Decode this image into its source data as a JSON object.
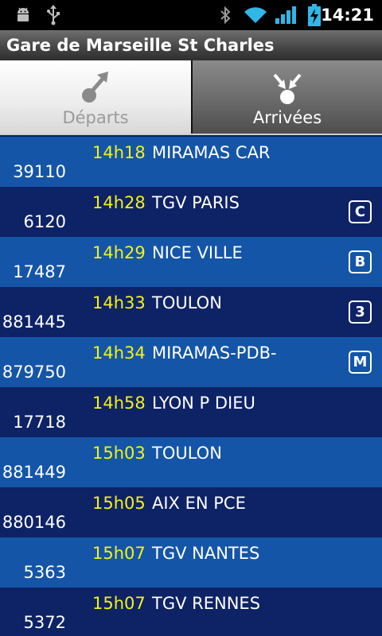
{
  "status_bar": {
    "time": "14:21",
    "icons": [
      "android-debug-icon",
      "usb-icon",
      "bluetooth-icon",
      "wifi-icon",
      "signal-icon",
      "battery-charging-icon"
    ]
  },
  "title": "Gare de Marseille St Charles",
  "tabs": [
    {
      "label": "Départs",
      "icon": "departures-icon",
      "selected": false
    },
    {
      "label": "Arrivées",
      "icon": "arrivals-icon",
      "selected": true
    }
  ],
  "trains": [
    {
      "time": "14h18",
      "destination": "MIRAMAS CAR",
      "number": "39110",
      "platform": ""
    },
    {
      "time": "14h28",
      "destination": "TGV PARIS",
      "number": "6120",
      "platform": "C"
    },
    {
      "time": "14h29",
      "destination": "NICE VILLE",
      "number": "17487",
      "platform": "B"
    },
    {
      "time": "14h33",
      "destination": "TOULON",
      "number": "881445",
      "platform": "3"
    },
    {
      "time": "14h34",
      "destination": "MIRAMAS-PDB-",
      "number": "879750",
      "platform": "M"
    },
    {
      "time": "14h58",
      "destination": "LYON P DIEU",
      "number": "17718",
      "platform": ""
    },
    {
      "time": "15h03",
      "destination": "TOULON",
      "number": "881449",
      "platform": ""
    },
    {
      "time": "15h05",
      "destination": "AIX EN PCE",
      "number": "880146",
      "platform": ""
    },
    {
      "time": "15h07",
      "destination": "TGV NANTES",
      "number": "5363",
      "platform": ""
    },
    {
      "time": "15h07",
      "destination": "TGV RENNES",
      "number": "5372",
      "platform": ""
    }
  ],
  "colors": {
    "row_light": "#1455a8",
    "row_dark": "#0e2266",
    "time_text": "#f2f21a"
  }
}
